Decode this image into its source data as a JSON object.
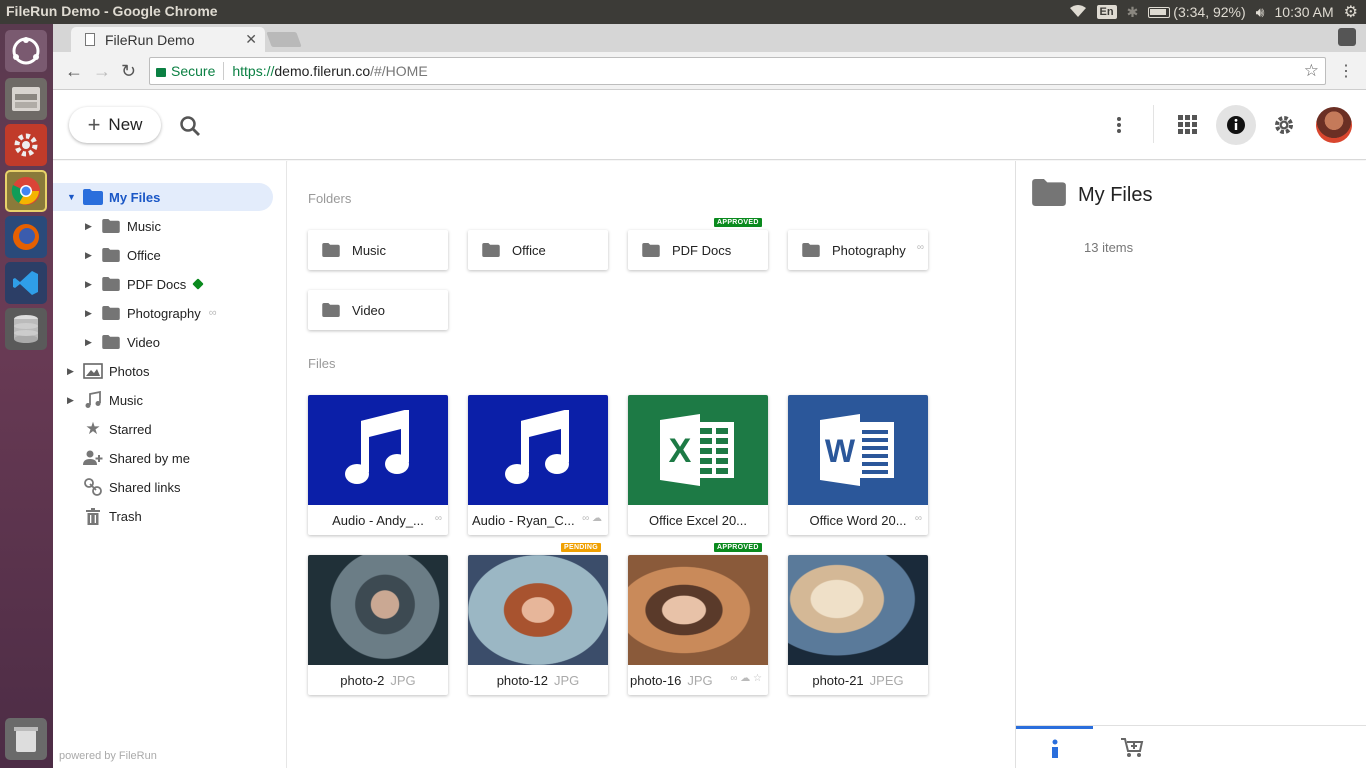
{
  "os": {
    "window_title": "FileRun Demo - Google Chrome",
    "keyboard": "En",
    "battery": "(3:34, 92%)",
    "clock": "10:30 AM"
  },
  "browser": {
    "tab_title": "FileRun Demo",
    "secure_label": "Secure",
    "url_scheme": "https://",
    "url_host": "demo.filerun.co",
    "url_path": "/#/HOME"
  },
  "header": {
    "new_label": "New"
  },
  "sidebar": {
    "my_files": "My Files",
    "folders": [
      "Music",
      "Office",
      "PDF Docs",
      "Photography",
      "Video"
    ],
    "sections": [
      "Photos",
      "Music",
      "Starred",
      "Shared by me",
      "Shared links",
      "Trash"
    ],
    "powered_by": "powered by FileRun"
  },
  "main": {
    "folders_label": "Folders",
    "files_label": "Files",
    "folders": [
      {
        "name": "Music",
        "badge": ""
      },
      {
        "name": "Office",
        "badge": ""
      },
      {
        "name": "PDF Docs",
        "badge": "APPROVED"
      },
      {
        "name": "Photography",
        "badge": ""
      },
      {
        "name": "Video",
        "badge": ""
      }
    ],
    "files": [
      {
        "name": "Audio - Andy_...",
        "ext": "",
        "type": "audio",
        "badge": ""
      },
      {
        "name": "Audio - Ryan_C...",
        "ext": "",
        "type": "audio",
        "badge": ""
      },
      {
        "name": "Office Excel 20...",
        "ext": "",
        "type": "excel",
        "badge": ""
      },
      {
        "name": "Office Word 20...",
        "ext": "",
        "type": "word",
        "badge": ""
      },
      {
        "name": "photo-2",
        "ext": "JPG",
        "type": "photo",
        "badge": ""
      },
      {
        "name": "photo-12",
        "ext": "JPG",
        "type": "photo",
        "badge": "PENDING"
      },
      {
        "name": "photo-16",
        "ext": "JPG",
        "type": "photo",
        "badge": "APPROVED"
      },
      {
        "name": "photo-21",
        "ext": "JPEG",
        "type": "photo",
        "badge": ""
      }
    ]
  },
  "details": {
    "title": "My Files",
    "count": "13 items"
  },
  "colors": {
    "audio_tile": "#0b1fa8",
    "excel_tile": "#1d7a45",
    "word_tile": "#2b579a",
    "active_blue": "#1a57c6",
    "approved_green": "#0a8a1e",
    "pending_orange": "#f0a000"
  }
}
